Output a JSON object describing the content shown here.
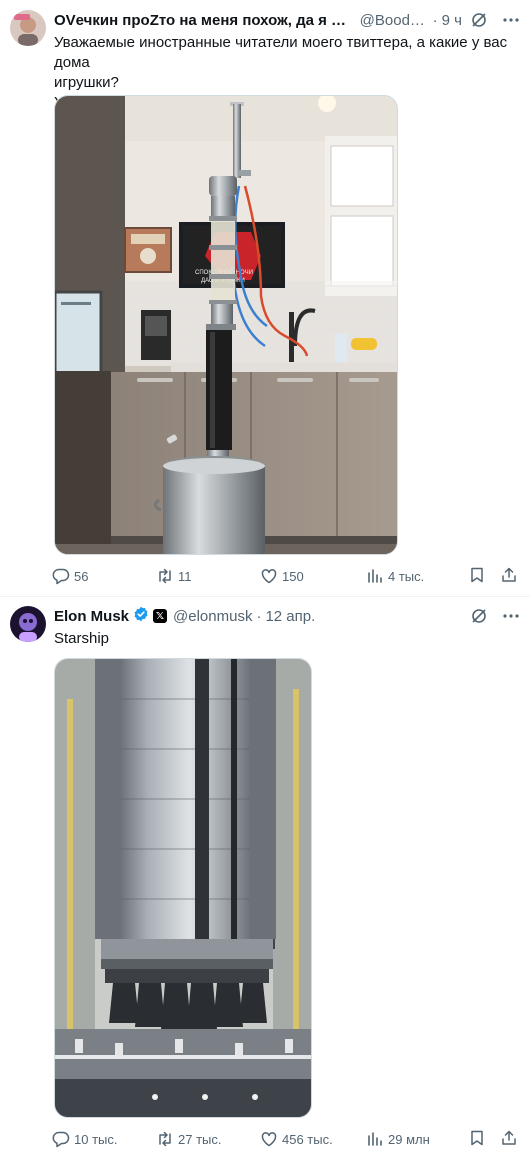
{
  "tweets": [
    {
      "author_name": "OVечкин проZто на меня похож, да я и поста...",
      "handle": "@Booddd...",
      "time": "9 ч",
      "text_lines": [
        "Уважаемые иностранные читатели моего твиттера, а какие у вас дома",
        "игрушки?",
        "У меня вот такая"
      ],
      "actions": {
        "replies": "56",
        "reposts": "11",
        "likes": "150",
        "views": "4 тыс."
      }
    },
    {
      "author_name": "Elon Musk",
      "handle": "@elonmusk",
      "time": "12 апр.",
      "text_lines": [
        "Starship"
      ],
      "actions": {
        "replies": "10 тыс.",
        "reposts": "27 тыс.",
        "likes": "456 тыс.",
        "views": "29 млн"
      }
    }
  ],
  "poster_text": [
    "СПОКОЙНОЙ НОЧИ",
    "ДАО И УТОЧКИ"
  ],
  "colors": {
    "text_primary": "#0f1419",
    "text_secondary": "#536471",
    "verified_blue": "#1d9bf0",
    "divider": "#eff3f4"
  },
  "icons": [
    "grok-icon",
    "more-icon",
    "reply-icon",
    "repost-icon",
    "like-icon",
    "views-icon",
    "bookmark-icon",
    "share-icon",
    "verified-icon",
    "x-affiliate-icon"
  ]
}
